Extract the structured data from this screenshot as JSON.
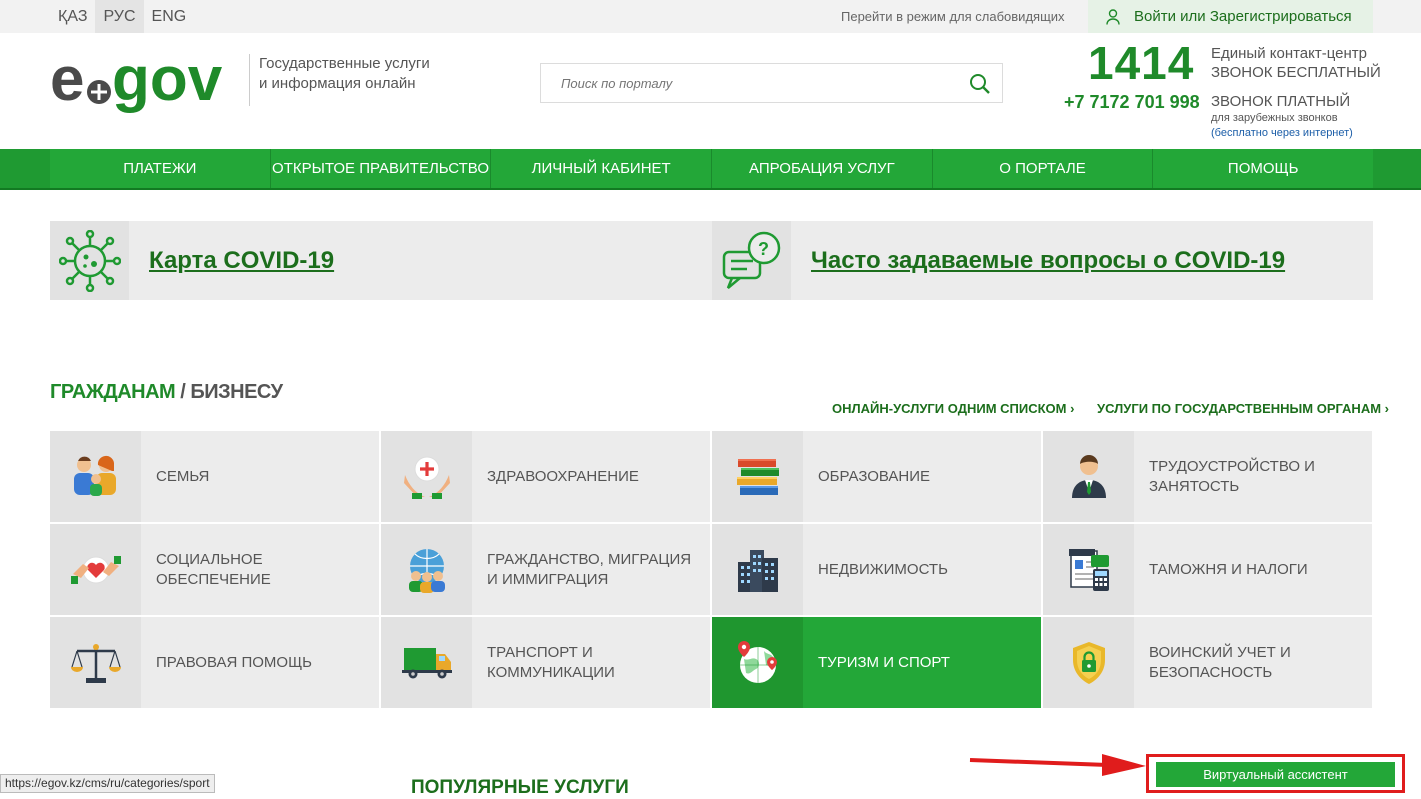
{
  "topbar": {
    "languages": [
      "ҚАЗ",
      "РУС",
      "ENG"
    ],
    "active_language": "РУС",
    "low_vision": "Перейти в режим для слабовидящих",
    "login": "Войти или Зарегистрироваться"
  },
  "header": {
    "logo_alt": "egov",
    "tagline_1": "Государственные услуги",
    "tagline_2": "и информация онлайн",
    "search_placeholder": "Поиск по порталу",
    "contact_number": "1414",
    "contact_center": "Единый контакт-центр",
    "free_call": "ЗВОНОК БЕСПЛАТНЫЙ",
    "paid_number": "+7 7172 701 998",
    "paid_call": "ЗВОНОК ПЛАТНЫЙ",
    "foreign_calls": "для зарубежных звонков",
    "free_internet": "(бесплатно через интернет)"
  },
  "nav": [
    {
      "label": "ПЛАТЕЖИ"
    },
    {
      "label": "ОТКРЫТОЕ ПРАВИТЕЛЬСТВО"
    },
    {
      "label": "ЛИЧНЫЙ КАБИНЕТ"
    },
    {
      "label": "АПРОБАЦИЯ УСЛУГ"
    },
    {
      "label": "О ПОРТАЛЕ"
    },
    {
      "label": "ПОМОЩЬ"
    }
  ],
  "covid": {
    "map": "Карта COVID-19",
    "faq": "Часто задаваемые вопросы о COVID-19"
  },
  "section": {
    "citizens": "ГРАЖДАНАМ",
    "separator": " / ",
    "business": "БИЗНЕСУ",
    "online_list": "ОНЛАЙН-УСЛУГИ ОДНИМ СПИСКОМ",
    "by_agency": "УСЛУГИ ПО ГОСУДАРСТВЕННЫМ ОРГАНАМ"
  },
  "categories": [
    {
      "label": "Семья",
      "icon": "family-icon"
    },
    {
      "label": "Здравоохранение",
      "icon": "healthcare-icon"
    },
    {
      "label": "Образование",
      "icon": "books-icon"
    },
    {
      "label": "Трудоустройство и занятость",
      "icon": "worker-icon"
    },
    {
      "label": "Социальное обеспечение",
      "icon": "heart-hands-icon"
    },
    {
      "label": "Гражданство, миграция и иммиграция",
      "icon": "globe-people-icon"
    },
    {
      "label": "Недвижимость",
      "icon": "buildings-icon"
    },
    {
      "label": "Таможня и налоги",
      "icon": "tax-document-icon"
    },
    {
      "label": "Правовая помощь",
      "icon": "scales-icon"
    },
    {
      "label": "Транспорт и коммуникации",
      "icon": "truck-icon"
    },
    {
      "label": "Туризм и спорт",
      "icon": "globe-pin-icon",
      "active": true
    },
    {
      "label": "Воинский учет и безопасность",
      "icon": "shield-lock-icon"
    }
  ],
  "popular": "ПОПУЛЯРНЫЕ УСЛУГИ",
  "status_url": "https://egov.kz/cms/ru/categories/sport",
  "assistant": "Виртуальный ассистент",
  "colors": {
    "brand_green": "#23a738",
    "dark_green": "#1c6e1c",
    "highlight_red": "#e01c1c"
  }
}
